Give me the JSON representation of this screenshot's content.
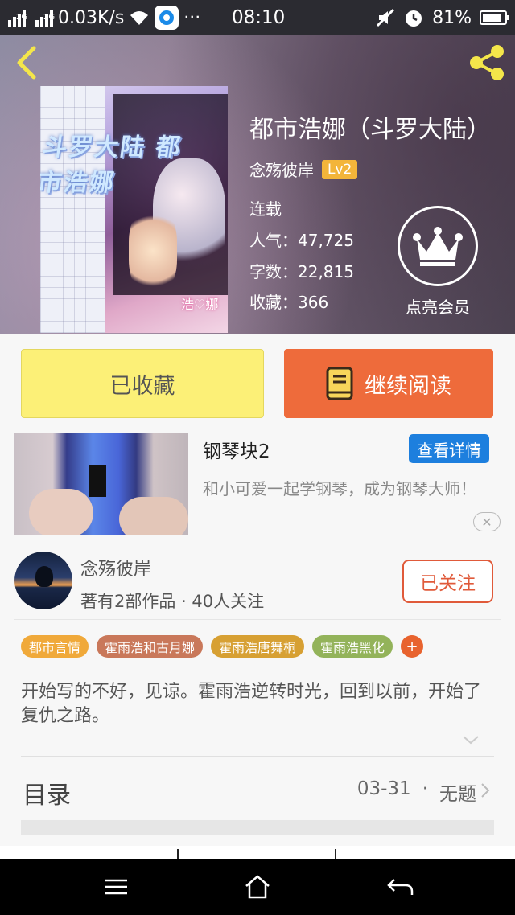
{
  "status_bar": {
    "network_tag_1": "2G",
    "network_tag_2": "2G",
    "speed": "0.03K/s",
    "dots": "···",
    "time": "08:10",
    "battery": "81%"
  },
  "book": {
    "title": "都市浩娜（斗罗大陆）",
    "author": "念殇彼岸",
    "level": "Lv2",
    "status": "连载",
    "popularity_label": "人气：",
    "popularity": "47,725",
    "words_label": "字数：",
    "words": "22,815",
    "favorites_label": "收藏：",
    "favorites": "366",
    "vip_label": "点亮会员",
    "cover_text": "斗罗大陆 都市浩娜",
    "cover_signature": "浩♡娜"
  },
  "actions": {
    "favorited_label": "已收藏",
    "continue_label": "继续阅读"
  },
  "ad": {
    "title": "钢琴块2",
    "detail_button": "查看详情",
    "description": "和小可爱一起学钢琴，成为钢琴大师！",
    "close": "✕"
  },
  "author_card": {
    "name": "念殇彼岸",
    "meta": "著有2部作品 · 40人关注",
    "follow_button": "已关注"
  },
  "tags": [
    {
      "label": "都市言情",
      "color": "#f0a93a"
    },
    {
      "label": "霍雨浩和古月娜",
      "color": "#c9785a"
    },
    {
      "label": "霍雨浩唐舞桐",
      "color": "#d7a033"
    },
    {
      "label": "霍雨浩黑化",
      "color": "#93b35a"
    }
  ],
  "tag_add": "+",
  "description": "开始写的不好，见谅。霍雨浩逆转时光，回到以前，开始了复仇之路。",
  "toc": {
    "label": "目录",
    "latest_date": "03-31",
    "separator": "·",
    "latest_title": "无题"
  },
  "colors": {
    "accent_orange": "#ee6b3b",
    "fav_yellow": "#fcf077",
    "link_blue": "#1d7fde",
    "follow_red": "#e05a3a"
  },
  "icons": [
    "back-icon",
    "share-icon",
    "crown-icon",
    "book-icon",
    "menu-icon",
    "home-icon",
    "return-icon"
  ]
}
